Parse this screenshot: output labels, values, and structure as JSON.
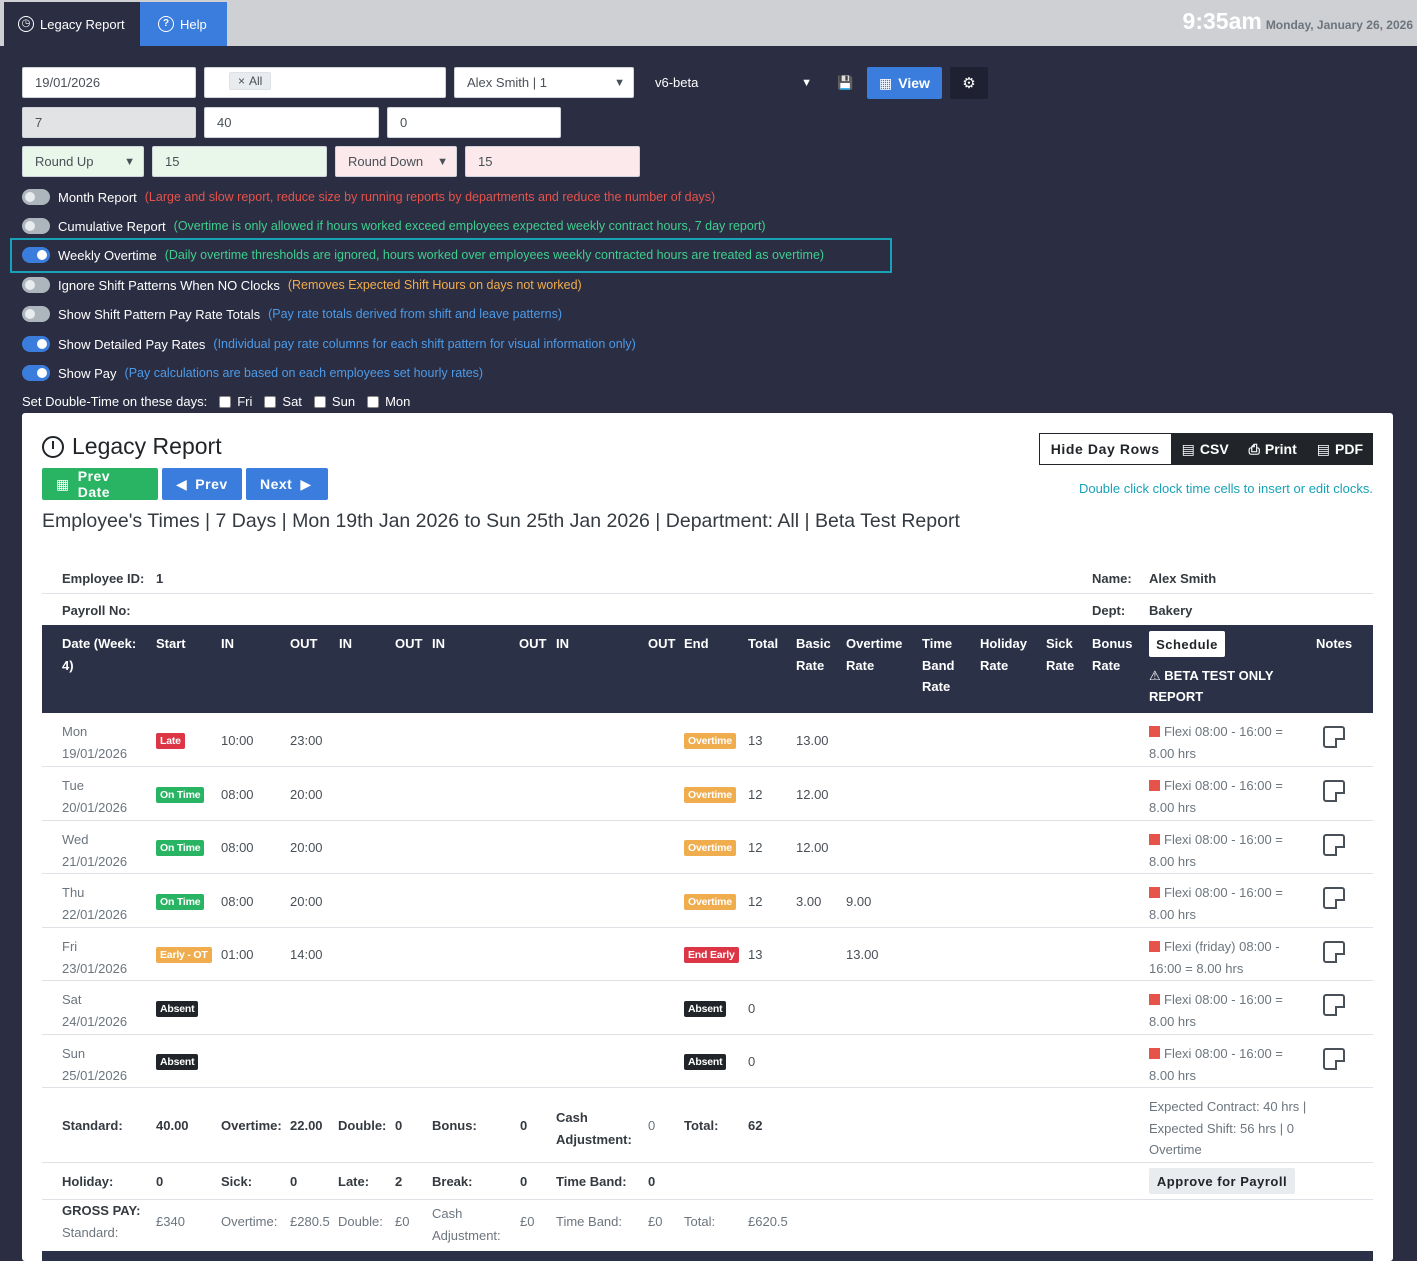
{
  "topbar": {
    "tabs": [
      {
        "label": "Legacy Report"
      },
      {
        "label": "Help"
      }
    ],
    "time": "9:35am",
    "date": "Monday, January 26, 2026"
  },
  "filters": {
    "start_date": "19/01/2026",
    "department_chip": "All",
    "employee": "Alex Smith | 1",
    "version": "v6-beta",
    "view_label": "View",
    "days": "7",
    "contract_hours": "40",
    "third_value": "0",
    "round_up": "Round Up",
    "round_up_mins": "15",
    "round_down": "Round Down",
    "round_down_mins": "15"
  },
  "toggles": [
    {
      "label": "Month Report",
      "note": "(Large and slow report, reduce size by running reports by departments and reduce the number of days)",
      "on": false
    },
    {
      "label": "Cumulative Report",
      "note": "(Overtime is only allowed if hours worked exceed employees expected weekly contract hours, 7 day report)",
      "on": false
    },
    {
      "label": "Weekly Overtime",
      "note": "(Daily overtime thresholds are ignored, hours worked over employees weekly contracted hours are treated as overtime)",
      "on": true
    },
    {
      "label": "Ignore Shift Patterns When NO Clocks",
      "note": "(Removes Expected Shift Hours on days not worked)",
      "on": false
    },
    {
      "label": "Show Shift Pattern Pay Rate Totals",
      "note": "(Pay rate totals derived from shift and leave patterns)",
      "on": false
    },
    {
      "label": "Show Detailed Pay Rates",
      "note": "(Individual pay rate columns for each shift pattern for visual information only)",
      "on": true
    },
    {
      "label": "Show Pay",
      "note": "(Pay calculations are based on each employees set hourly rates)",
      "on": true
    }
  ],
  "double_time": {
    "label": "Set Double-Time on these days:",
    "days": [
      "Fri",
      "Sat",
      "Sun",
      "Mon"
    ]
  },
  "report": {
    "title": "Legacy Report",
    "prev_date": "Prev Date",
    "prev": "Prev",
    "next": "Next",
    "hide_rows": "Hide Day Rows",
    "csv": "CSV",
    "print": "Print",
    "pdf": "PDF",
    "hint": "Double click clock time cells to insert or edit clocks.",
    "subtitle": "Employee's Times | 7 Days | Mon 19th Jan 2026 to Sun 25th Jan 2026 | Department: All | Beta Test Report"
  },
  "employee": {
    "id_label": "Employee ID:",
    "id": "1",
    "name_label": "Name:",
    "name": "Alex Smith",
    "payroll_label": "Payroll No:",
    "dept_label": "Dept:",
    "dept": "Bakery"
  },
  "headers": {
    "date": "Date (Week: 4)",
    "start": "Start",
    "in1": "IN",
    "out1": "OUT",
    "in2": "IN",
    "out2": "OUT",
    "in3": "IN",
    "out3": "OUT",
    "in4": "IN",
    "out4": "OUT",
    "end": "End",
    "total": "Total",
    "basic": "Basic Rate",
    "overtime": "Overtime Rate",
    "timeband": "Time Band Rate",
    "holiday": "Holiday Rate",
    "sick": "Sick Rate",
    "bonus": "Bonus Rate",
    "schedule": "Schedule",
    "beta": "BETA TEST ONLY REPORT",
    "notes": "Notes"
  },
  "rows": [
    {
      "day": "Mon",
      "date": "19/01/2026",
      "start_badge": "Late",
      "start_color": "red",
      "in": "10:00",
      "out": "23:00",
      "end_badge": "Overtime",
      "end_color": "orange",
      "total": "13",
      "basic": "13.00",
      "ot": "",
      "shift": "Flexi 08:00 - 16:00 = 8.00 hrs"
    },
    {
      "day": "Tue",
      "date": "20/01/2026",
      "start_badge": "On Time",
      "start_color": "green",
      "in": "08:00",
      "out": "20:00",
      "end_badge": "Overtime",
      "end_color": "orange",
      "total": "12",
      "basic": "12.00",
      "ot": "",
      "shift": "Flexi 08:00 - 16:00 = 8.00 hrs"
    },
    {
      "day": "Wed",
      "date": "21/01/2026",
      "start_badge": "On Time",
      "start_color": "green",
      "in": "08:00",
      "out": "20:00",
      "end_badge": "Overtime",
      "end_color": "orange",
      "total": "12",
      "basic": "12.00",
      "ot": "",
      "shift": "Flexi 08:00 - 16:00 = 8.00 hrs"
    },
    {
      "day": "Thu",
      "date": "22/01/2026",
      "start_badge": "On Time",
      "start_color": "green",
      "in": "08:00",
      "out": "20:00",
      "end_badge": "Overtime",
      "end_color": "orange",
      "total": "12",
      "basic": "3.00",
      "ot": "9.00",
      "shift": "Flexi 08:00 - 16:00 = 8.00 hrs"
    },
    {
      "day": "Fri",
      "date": "23/01/2026",
      "start_badge": "Early - OT",
      "start_color": "orange",
      "in": "01:00",
      "out": "14:00",
      "end_badge": "End Early",
      "end_color": "red",
      "total": "13",
      "basic": "",
      "ot": "13.00",
      "shift": "Flexi (friday) 08:00 - 16:00 = 8.00 hrs"
    },
    {
      "day": "Sat",
      "date": "24/01/2026",
      "start_badge": "Absent",
      "start_color": "dark",
      "in": "",
      "out": "",
      "end_badge": "Absent",
      "end_color": "dark",
      "total": "0",
      "basic": "",
      "ot": "",
      "shift": "Flexi 08:00 - 16:00 = 8.00 hrs"
    },
    {
      "day": "Sun",
      "date": "25/01/2026",
      "start_badge": "Absent",
      "start_color": "dark",
      "in": "",
      "out": "",
      "end_badge": "Absent",
      "end_color": "dark",
      "total": "0",
      "basic": "",
      "ot": "",
      "shift": "Flexi 08:00 - 16:00 = 8.00 hrs"
    }
  ],
  "summary": {
    "standard_label": "Standard:",
    "standard": "40.00",
    "overtime_label": "Overtime:",
    "overtime": "22.00",
    "double_label": "Double:",
    "double": "0",
    "bonus_label": "Bonus:",
    "bonus": "0",
    "cash_label": "Cash Adjustment:",
    "cash": "0",
    "total_label": "Total:",
    "total": "62",
    "expected": "Expected Contract: 40 hrs | Expected Shift: 56 hrs | 0 Overtime",
    "holiday_label": "Holiday:",
    "holiday": "0",
    "sick_label": "Sick:",
    "sick": "0",
    "late_label": "Late:",
    "late": "2",
    "break_label": "Break:",
    "break": "0",
    "timeband_label": "Time Band:",
    "timeband": "0",
    "approve": "Approve for Payroll",
    "gross_label": "GROSS PAY:",
    "gp_standard_label": "Standard:",
    "gp_standard": "£340",
    "gp_overtime_label": "Overtime:",
    "gp_overtime": "£280.5",
    "gp_double_label": "Double:",
    "gp_double": "£0",
    "gp_cash_label": "Cash Adjustment:",
    "gp_cash": "£0",
    "gp_timeband_label": "Time Band:",
    "gp_timeband": "£0",
    "gp_total_label": "Total:",
    "gp_total": "£620.5"
  }
}
